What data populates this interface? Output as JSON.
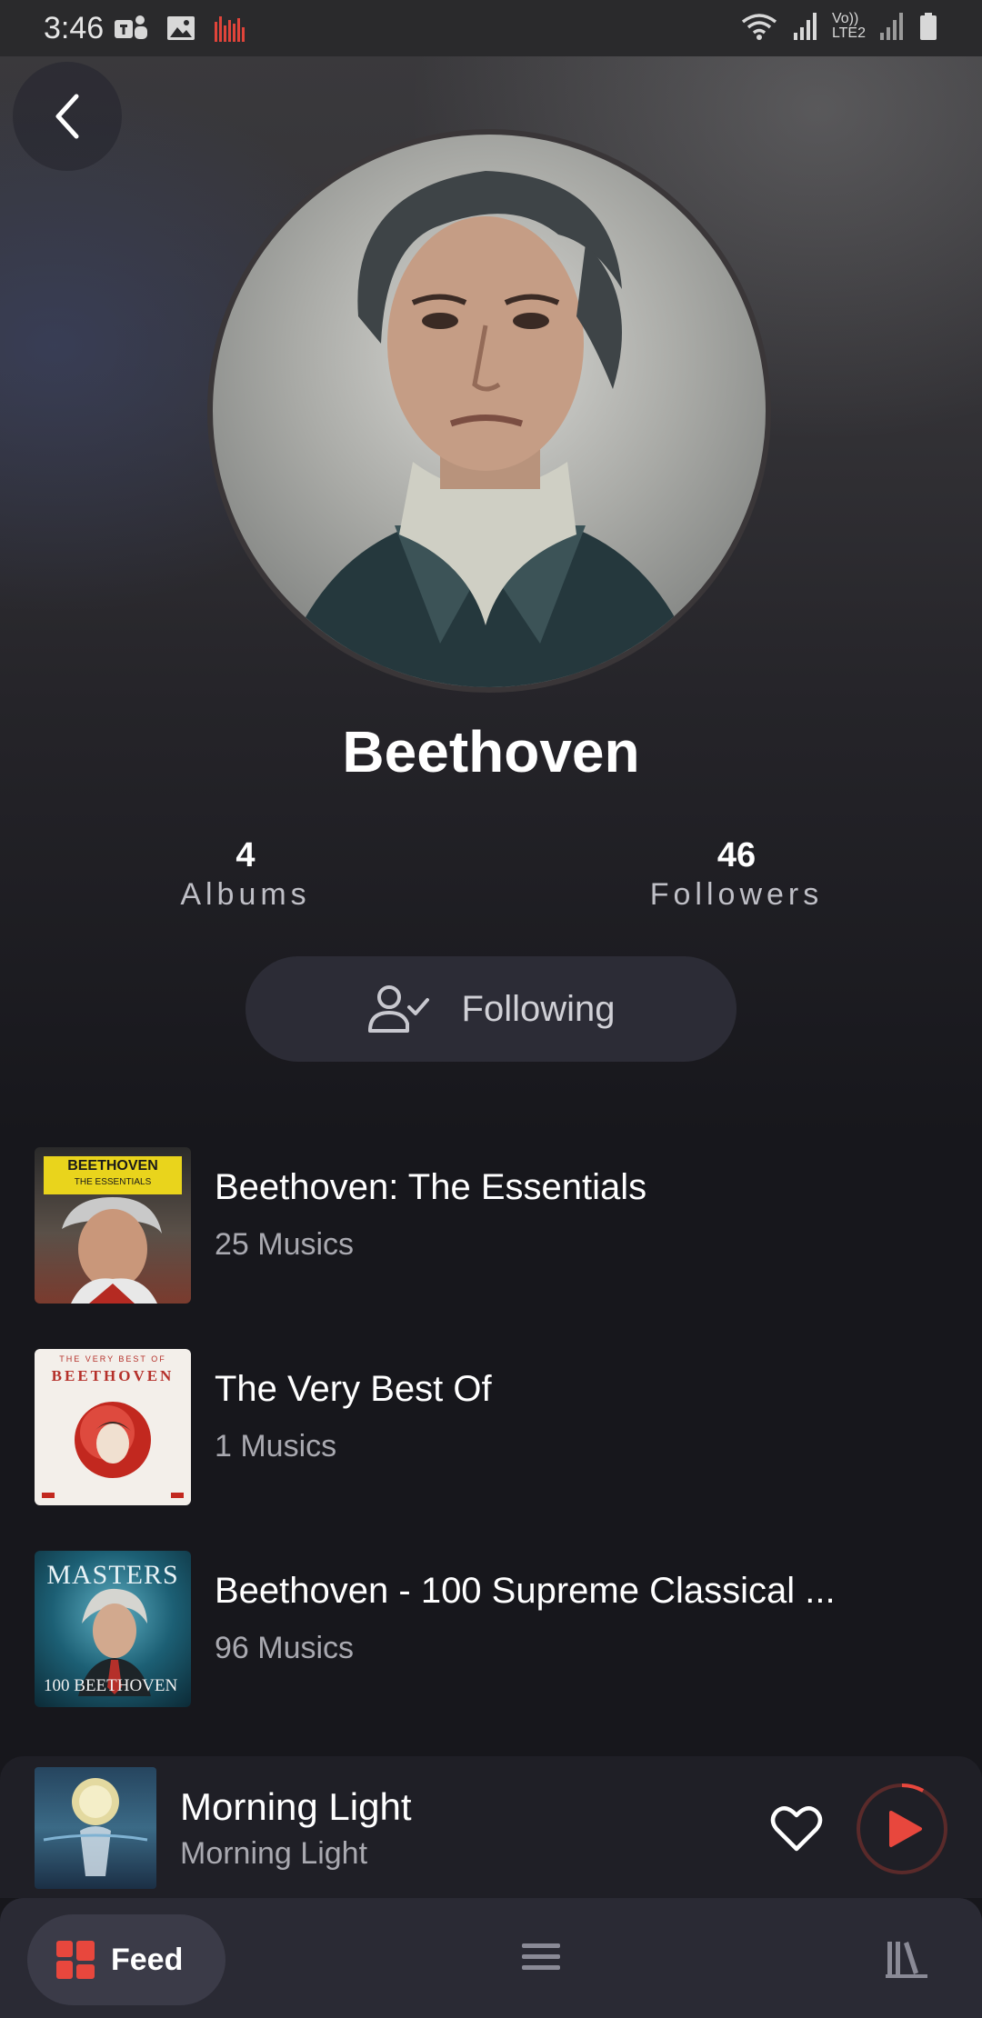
{
  "status_bar": {
    "time": "3:46",
    "left_icons": [
      "teams-icon",
      "gallery-icon",
      "audio-app-icon"
    ],
    "right_icons": [
      "wifi-icon",
      "signal-icon",
      "volte-icon",
      "signal-icon",
      "battery-icon"
    ],
    "volte_label": "Vo))",
    "lte_label": "LTE2"
  },
  "header": {
    "back_icon": "chevron-left-icon"
  },
  "artist": {
    "name": "Beethoven",
    "albums_count": "4",
    "albums_label": "Albums",
    "followers_count": "46",
    "followers_label": "Followers",
    "follow_button_label": "Following"
  },
  "albums": [
    {
      "title": "Beethoven: The Essentials",
      "count": "25 Musics",
      "cover_text_1": "BEETHOVEN",
      "cover_text_2": "THE ESSENTIALS"
    },
    {
      "title": "The Very Best Of",
      "count": "1 Musics",
      "cover_text_1": "THE VERY BEST OF",
      "cover_text_2": "BEETHOVEN"
    },
    {
      "title": "Beethoven - 100 Supreme Classical ...",
      "count": "96 Musics",
      "cover_text_1": "MASTERS",
      "cover_text_2": "100 BEETHOVEN"
    }
  ],
  "now_playing": {
    "title": "Morning Light",
    "subtitle": "Morning Light",
    "progress": 0.08
  },
  "bottom_nav": {
    "feed_label": "Feed"
  },
  "colors": {
    "accent": "#e8473d",
    "background": "#17171c",
    "button": "#2c2c36"
  }
}
